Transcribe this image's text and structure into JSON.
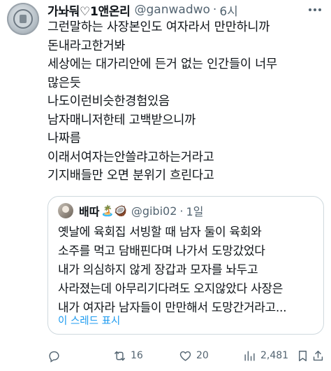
{
  "tweet": {
    "author_name": "가놔둬♡1앤온리",
    "handle": "@ganwadwo",
    "separator": "·",
    "time": "6시",
    "lines": [
      "그런말하는 사장본인도 여자라서 만만하니까",
      "돈내라고한거봐",
      "세상에는 대가리안에 든거 없는 인간들이 너무",
      "많은듯",
      "나도이런비슷한경험있음",
      "남자매니저한테 고백받으니까",
      "나짜름",
      "이래서여자는안쓸랴고하는거라고",
      "기지배들만 오면 분위기 흐린다고"
    ]
  },
  "quote": {
    "author_name": "배따",
    "emojis": "🏝️🥥",
    "handle": "@gibi02",
    "separator": "·",
    "time": "1일",
    "lines": [
      "옛날에 육회집 서빙할 때 남자 둘이 육회와",
      "소주를 먹고 담배핀다며 나가서 도망갔었다",
      "내가 의심하지 않게 장갑과 모자를 놔두고",
      "사라졌는데 아무리기다려도 오지않았다 사장은",
      "내가 여자라 남자들이 만만해서 도망간거라고..."
    ],
    "show_thread": "이 스레드 표시"
  },
  "actions": {
    "retweets": "16",
    "likes": "20",
    "views": "2,481"
  }
}
